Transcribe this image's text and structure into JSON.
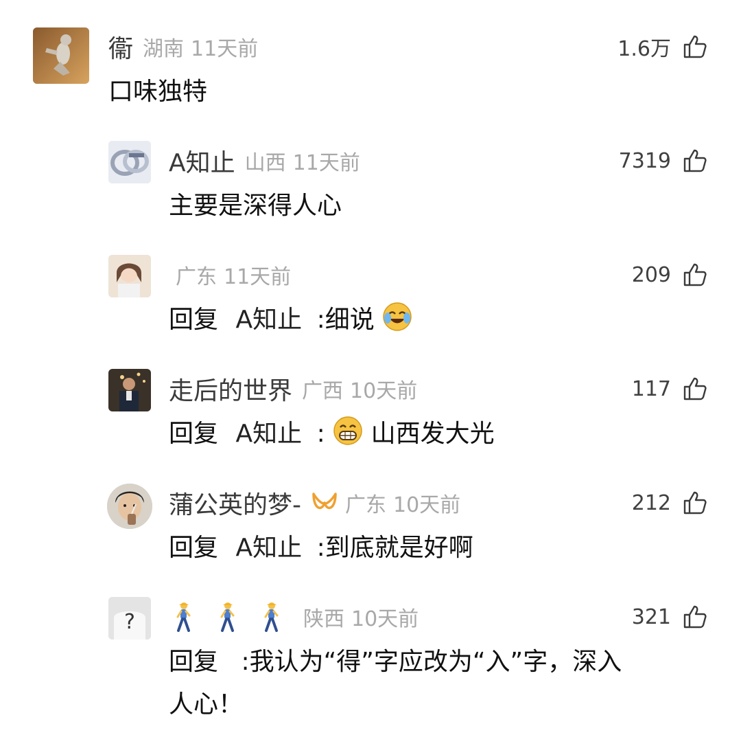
{
  "comments": [
    {
      "name": "衞",
      "region": "湖南",
      "time": "11天前",
      "likes": "1.6万",
      "text": "口味独特",
      "avatar": "cat-dancing-avatar"
    },
    {
      "name": "A知止",
      "region": "山西",
      "time": "11天前",
      "likes": "7319",
      "text": "主要是深得人心",
      "avatar": "rings-avatar"
    },
    {
      "name": "",
      "region": "广东",
      "time": "11天前",
      "likes": "209",
      "reply_prefix": "回复",
      "reply_to": "A知止",
      "text": ":细说",
      "avatar": "girl-portrait-avatar",
      "emoji": "laughing-crying-emoji"
    },
    {
      "name": "走后的世界",
      "region": "广西",
      "time": "10天前",
      "likes": "117",
      "reply_prefix": "回复",
      "reply_to": "A知止",
      "text": "山西发大光",
      "text_prefix": ":",
      "avatar": "man-night-avatar",
      "emoji": "grinning-emoji"
    },
    {
      "name": "蒲公英的梦-",
      "region": "广东",
      "time": "10天前",
      "likes": "212",
      "reply_prefix": "回复",
      "reply_to": "A知止",
      "text": ":到底就是好啊",
      "avatar": "man-drinking-avatar",
      "badge": "ribbon-badge-icon"
    },
    {
      "name": "",
      "region": "陕西",
      "time": "10天前",
      "likes": "321",
      "reply_prefix": "回复",
      "text_line1": ":我认为“得”字应改为“入”字，深入",
      "text_line2": "人心！",
      "avatar": "question-mark-avatar",
      "name_icons": [
        "walking-man-icon",
        "walking-man-icon",
        "walking-man-icon"
      ]
    }
  ],
  "colors": {
    "name": "#3a3a3a",
    "meta": "#a8a8a8",
    "text": "#111111",
    "badge": "#f0a030"
  }
}
